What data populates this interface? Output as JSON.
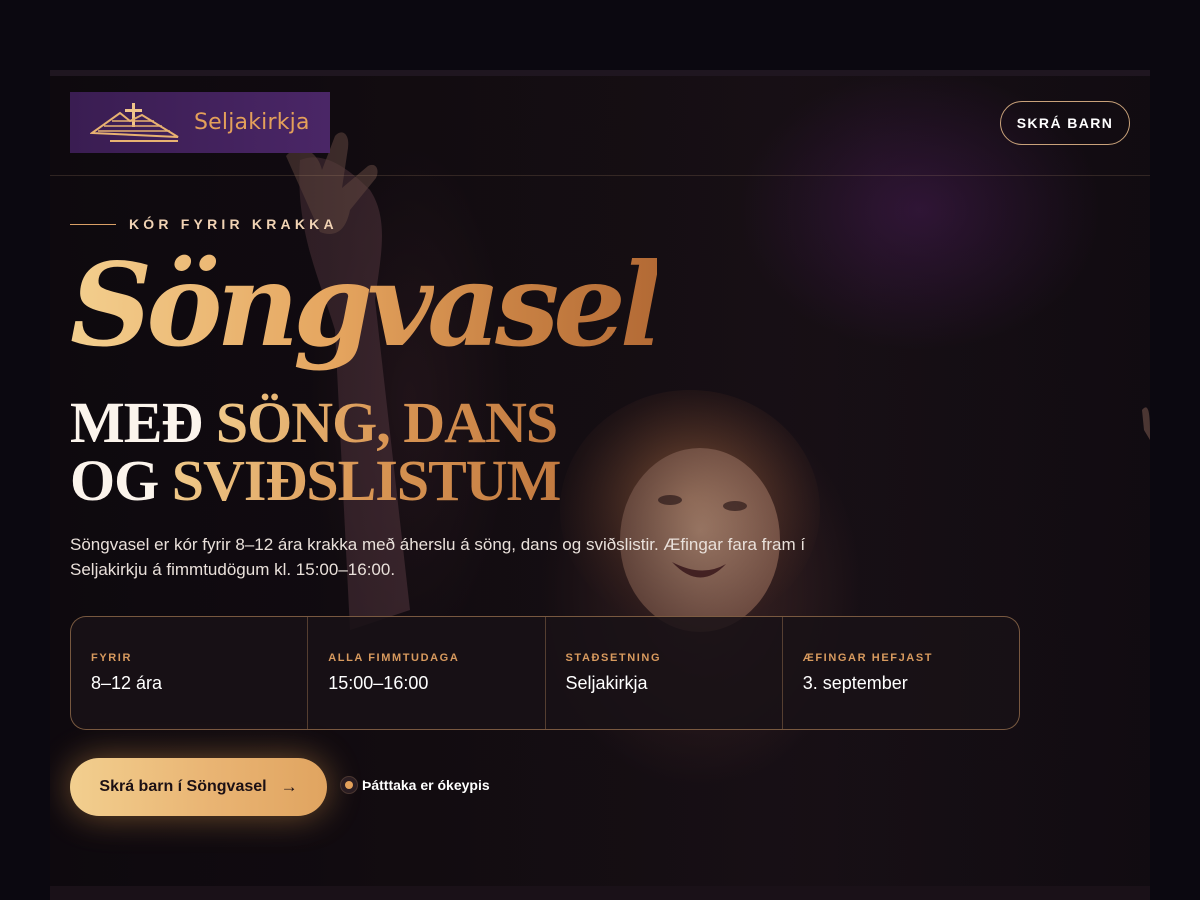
{
  "header": {
    "logo_text": "Seljakirkja",
    "register_button": "SKRÁ BARN"
  },
  "hero": {
    "eyebrow": "KÓR FYRIR KRAKKA",
    "brand": "Söngvasel",
    "headline": {
      "line1_white": "MEÐ ",
      "line1_gold": "SÖNG, DANS",
      "line2_white": "OG ",
      "line2_gold": "SVIÐSLISTUM"
    },
    "intro": "Söngvasel er kór fyrir 8–12 ára krakka með áherslu á söng, dans og sviðslistir. Æfingar fara fram í Seljakirkju á fimmtudögum kl. 15:00–16:00."
  },
  "facts": [
    {
      "label": "FYRIR",
      "value": "8–12 ára"
    },
    {
      "label": "ALLA FIMMTUDAGA",
      "value": "15:00–16:00"
    },
    {
      "label": "STAÐSETNING",
      "value": "Seljakirkja"
    },
    {
      "label": "ÆFINGAR HEFJAST",
      "value": "3. september"
    }
  ],
  "cta": {
    "label": "Skrá barn í Söngvasel",
    "arrow": "→"
  },
  "note": "Þátttaka er ókeypis",
  "colors": {
    "background": "#0b0810",
    "gold_accent": "#e0a460",
    "logo_purple": "#3a1d52"
  },
  "icons": {
    "logo": "church-cross-logo-icon",
    "cta": "arrow-right-icon",
    "note": "dot-icon"
  }
}
